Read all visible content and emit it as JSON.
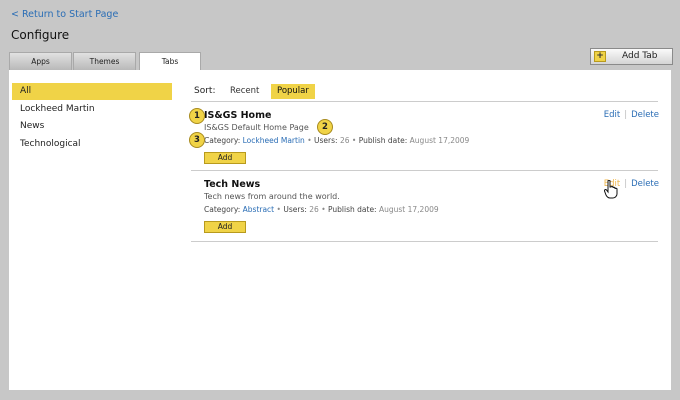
{
  "nav": {
    "back_label": "< Return to Start Page"
  },
  "page": {
    "title": "Configure"
  },
  "tabs": [
    {
      "label": "Apps"
    },
    {
      "label": "Themes"
    },
    {
      "label": "Tabs",
      "active": true
    }
  ],
  "toolbar": {
    "add_tab_label": "Add Tab",
    "add_tab_icon": "+"
  },
  "sidebar": {
    "items": [
      {
        "label": "All",
        "active": true
      },
      {
        "label": "Lockheed Martin"
      },
      {
        "label": "News"
      },
      {
        "label": "Technological"
      }
    ]
  },
  "sort": {
    "label": "Sort:",
    "options": [
      "Recent",
      "Popular"
    ],
    "selected": "Popular"
  },
  "entries": [
    {
      "title": "IS&GS Home",
      "description": "IS&GS Default Home Page",
      "category_label": "Category:",
      "category": "Lockheed Martin",
      "users_label": "Users:",
      "users": "26",
      "publish_label": "Publish date:",
      "publish_date": "August 17,2009",
      "add_label": "Add",
      "edit_label": "Edit",
      "delete_label": "Delete"
    },
    {
      "title": "Tech News",
      "description": "Tech news from around the world.",
      "category_label": "Category:",
      "category": "Abstract",
      "users_label": "Users:",
      "users": "26",
      "publish_label": "Publish date:",
      "publish_date": "August 17,2009",
      "add_label": "Add",
      "edit_label": "Edit",
      "delete_label": "Delete"
    }
  ],
  "callouts": [
    "1",
    "2",
    "3"
  ],
  "colors": {
    "accent": "#f0d347",
    "link": "#2a6db5",
    "link_hover": "#f0b64a",
    "background": "#c7c7c7"
  },
  "icons": {
    "cursor": "hand-pointer-icon"
  }
}
